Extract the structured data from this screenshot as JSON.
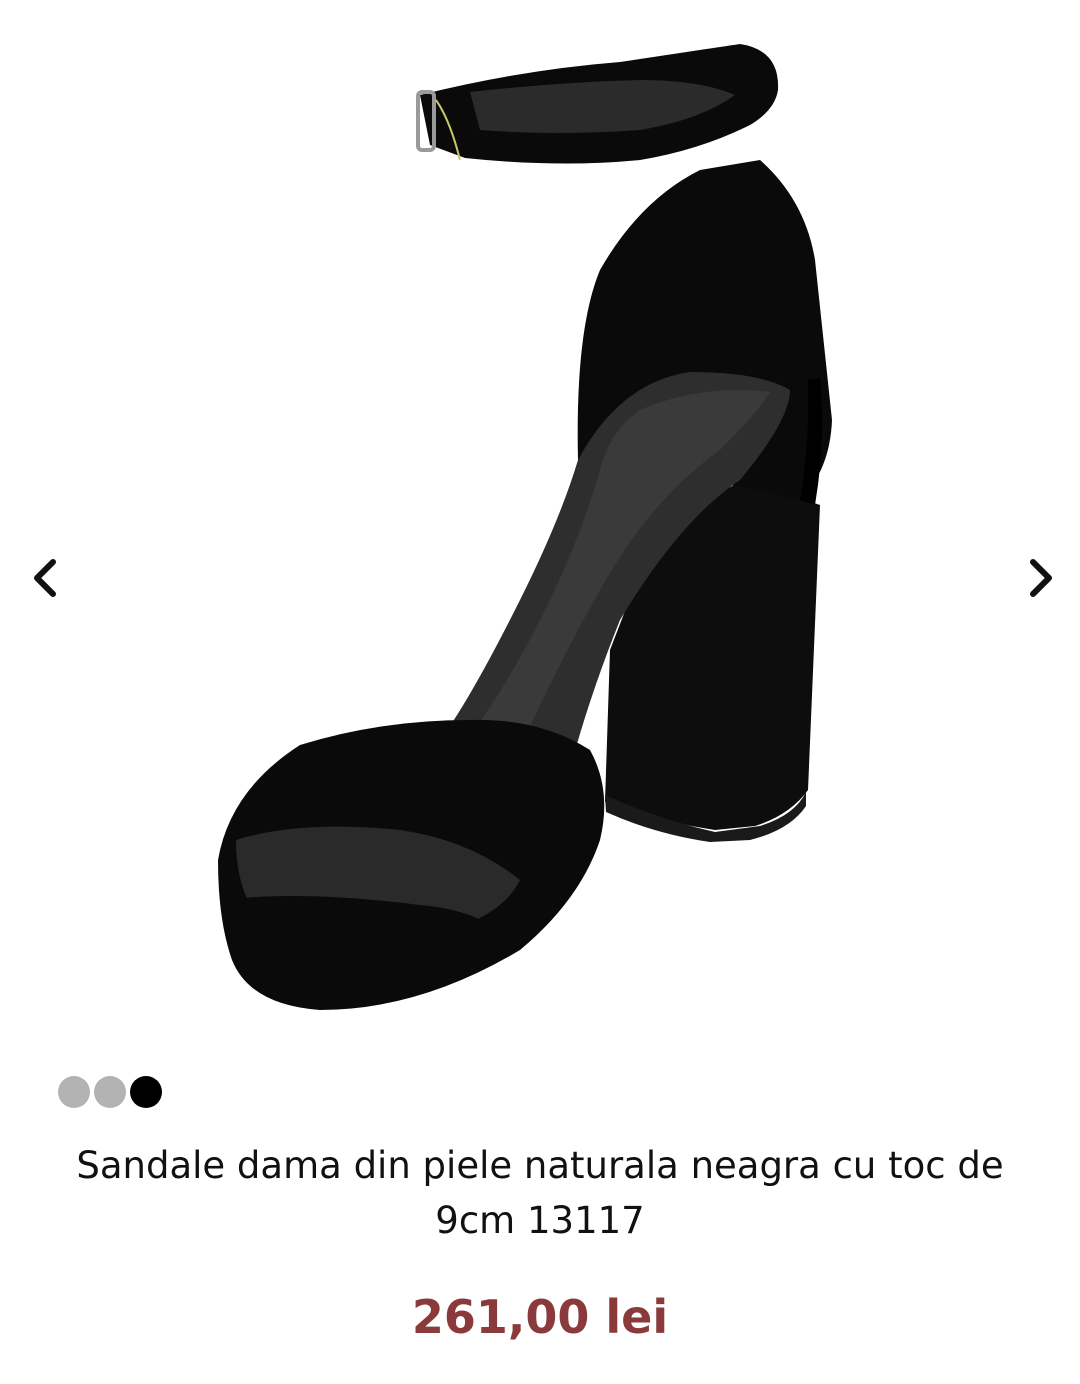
{
  "gallery": {
    "image_alt": "black-suede-block-heel-sandal",
    "prev_icon": "chevron-left-icon",
    "next_icon": "chevron-right-icon",
    "dots": [
      {
        "active": false
      },
      {
        "active": false
      },
      {
        "active": true
      }
    ],
    "dot_colors": {
      "inactive": "#b3b3b3",
      "active": "#000000"
    }
  },
  "product": {
    "title": "Sandale dama din piele naturala neagra cu toc de 9cm 13117",
    "price": "261,00 lei",
    "price_color": "#8a3a3a"
  }
}
